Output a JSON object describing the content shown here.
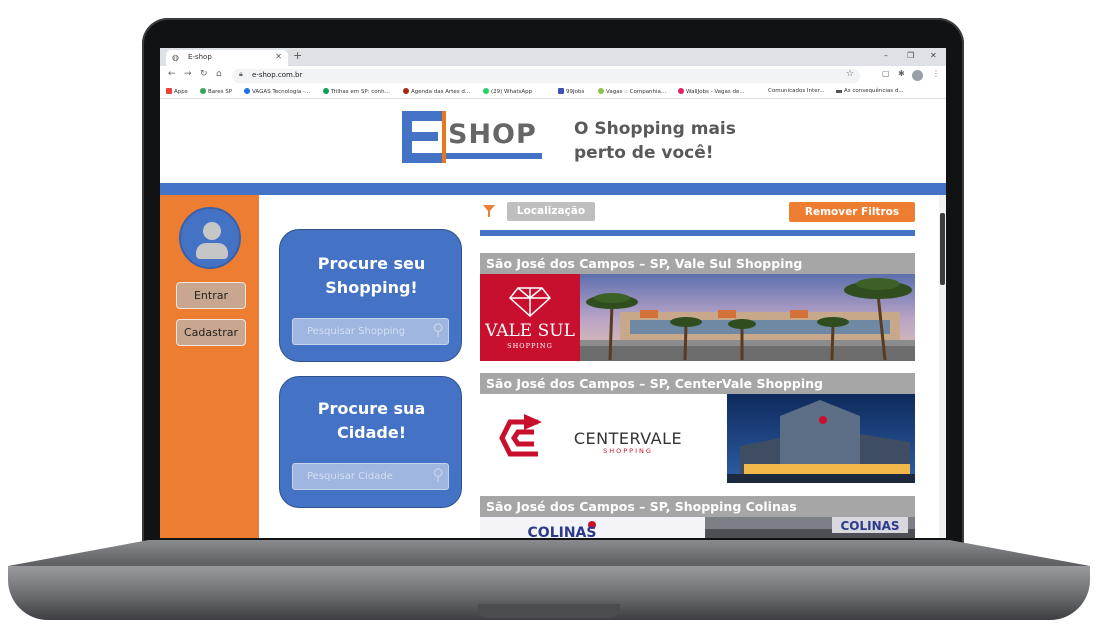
{
  "browser": {
    "tab_title": "E-shop",
    "url": "e-shop.com.br",
    "bookmarks": [
      "Apps",
      "Bares SP",
      "VAGAS Tecnologia -...",
      "Trilhas em SP: conh...",
      "Agenda das Artes d...",
      "(29) WhatsApp",
      "99Jobs",
      "Vagas :: Companhia...",
      "WallJobs - Vagas de...",
      "Comunicados Inter...",
      "As consequências d..."
    ]
  },
  "header": {
    "logo_text": "SHOP",
    "slogan_line1": "O Shopping mais",
    "slogan_line2": "perto de você!"
  },
  "sidebar": {
    "login_label": "Entrar",
    "register_label": "Cadastrar"
  },
  "search_shopping": {
    "title_line1": "Procure seu",
    "title_line2": "Shopping!",
    "placeholder": "Pesquisar Shopping"
  },
  "search_city": {
    "title_line1": "Procure sua",
    "title_line2": "Cidade!",
    "placeholder": "Pesquisar Cidade"
  },
  "filters": {
    "location_label": "Localização",
    "remove_label": "Remover Filtros"
  },
  "malls": [
    {
      "title": "São José dos Campos – SP, Vale Sul Shopping",
      "brand_line1": "VALE SUL",
      "brand_line2": "SHOPPING"
    },
    {
      "title": "São José dos Campos – SP, CenterVale Shopping",
      "brand_line1": "CENTERVALE",
      "brand_line2": "SHOPPING"
    },
    {
      "title": "São José dos Campos – SP, Shopping Colinas",
      "brand_line1": "COLINAS",
      "brand_line2": "COLINAS"
    }
  ],
  "colors": {
    "blue": "#4472c4",
    "orange": "#ed7d31",
    "gray": "#a6a6a6",
    "valesul_red": "#c00000",
    "centervale_red": "#c8102e"
  }
}
